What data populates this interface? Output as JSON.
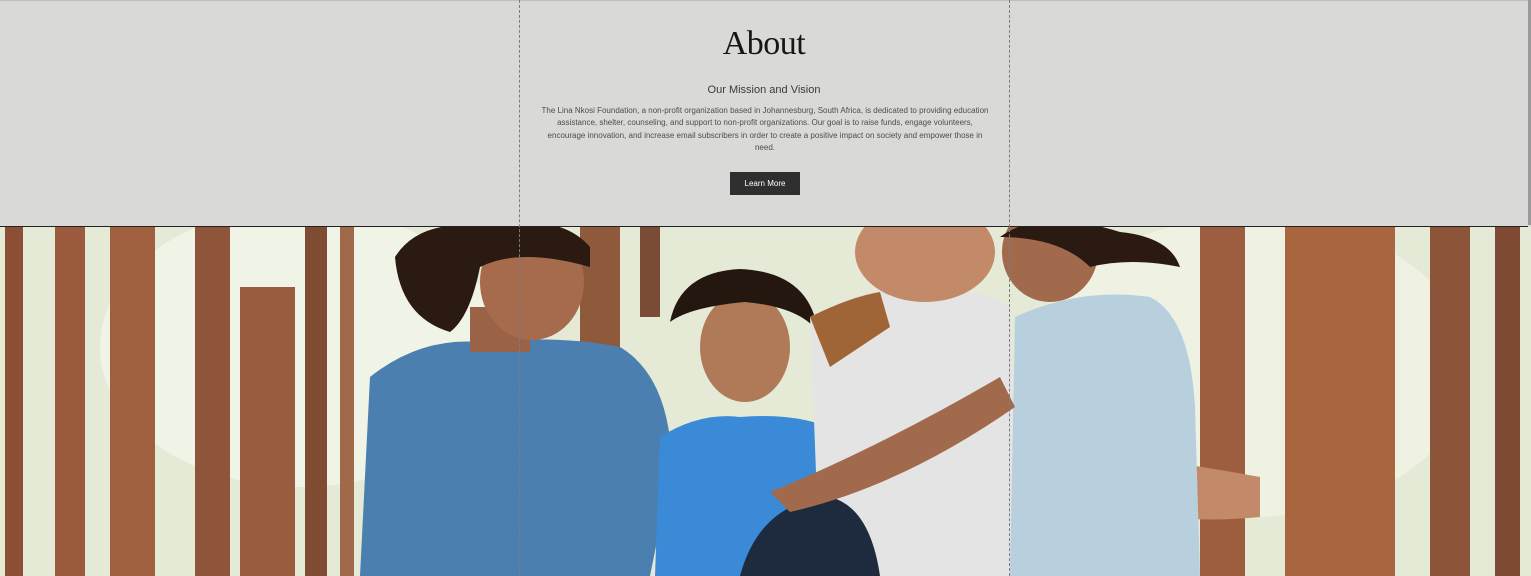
{
  "about": {
    "title": "About",
    "subtitle": "Our Mission and Vision",
    "body": "The Lina Nkosi Foundation, a non-profit organization based in Johannesburg, South Africa, is dedicated to providing education assistance, shelter, counseling, and support to non-profit organizations. Our goal is to raise funds, engage volunteers, encourage innovation, and increase email subscribers in order to create a positive impact on society and empower those in need.",
    "button_label": "Learn More"
  },
  "colors": {
    "section_bg": "#d9dad8",
    "button_bg": "#2f2f2f",
    "button_text": "#ffffff"
  }
}
